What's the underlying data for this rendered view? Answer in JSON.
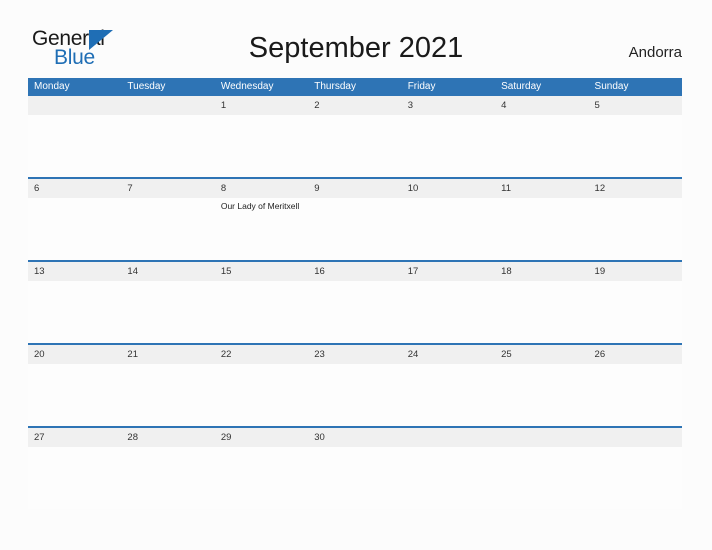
{
  "logo": {
    "word_one": "General",
    "word_two": "Blue",
    "triangle_icon": "triangle-icon",
    "brand_color": "#1f6eb5"
  },
  "header": {
    "title": "September 2021",
    "region": "Andorra"
  },
  "colors": {
    "header_band": "#2e74b5",
    "date_band": "#f0f0f0",
    "row_divider": "#2e74b5",
    "page_background": "#fcfcfc",
    "text": "#1a1a1a"
  },
  "calendar": {
    "weekdays": [
      "Monday",
      "Tuesday",
      "Wednesday",
      "Thursday",
      "Friday",
      "Saturday",
      "Sunday"
    ],
    "weeks": [
      [
        {
          "date": "",
          "events": []
        },
        {
          "date": "",
          "events": []
        },
        {
          "date": "1",
          "events": []
        },
        {
          "date": "2",
          "events": []
        },
        {
          "date": "3",
          "events": []
        },
        {
          "date": "4",
          "events": []
        },
        {
          "date": "5",
          "events": []
        }
      ],
      [
        {
          "date": "6",
          "events": []
        },
        {
          "date": "7",
          "events": []
        },
        {
          "date": "8",
          "events": [
            "Our Lady of Meritxell"
          ]
        },
        {
          "date": "9",
          "events": []
        },
        {
          "date": "10",
          "events": []
        },
        {
          "date": "11",
          "events": []
        },
        {
          "date": "12",
          "events": []
        }
      ],
      [
        {
          "date": "13",
          "events": []
        },
        {
          "date": "14",
          "events": []
        },
        {
          "date": "15",
          "events": []
        },
        {
          "date": "16",
          "events": []
        },
        {
          "date": "17",
          "events": []
        },
        {
          "date": "18",
          "events": []
        },
        {
          "date": "19",
          "events": []
        }
      ],
      [
        {
          "date": "20",
          "events": []
        },
        {
          "date": "21",
          "events": []
        },
        {
          "date": "22",
          "events": []
        },
        {
          "date": "23",
          "events": []
        },
        {
          "date": "24",
          "events": []
        },
        {
          "date": "25",
          "events": []
        },
        {
          "date": "26",
          "events": []
        }
      ],
      [
        {
          "date": "27",
          "events": []
        },
        {
          "date": "28",
          "events": []
        },
        {
          "date": "29",
          "events": []
        },
        {
          "date": "30",
          "events": []
        },
        {
          "date": "",
          "events": []
        },
        {
          "date": "",
          "events": []
        },
        {
          "date": "",
          "events": []
        }
      ]
    ]
  }
}
